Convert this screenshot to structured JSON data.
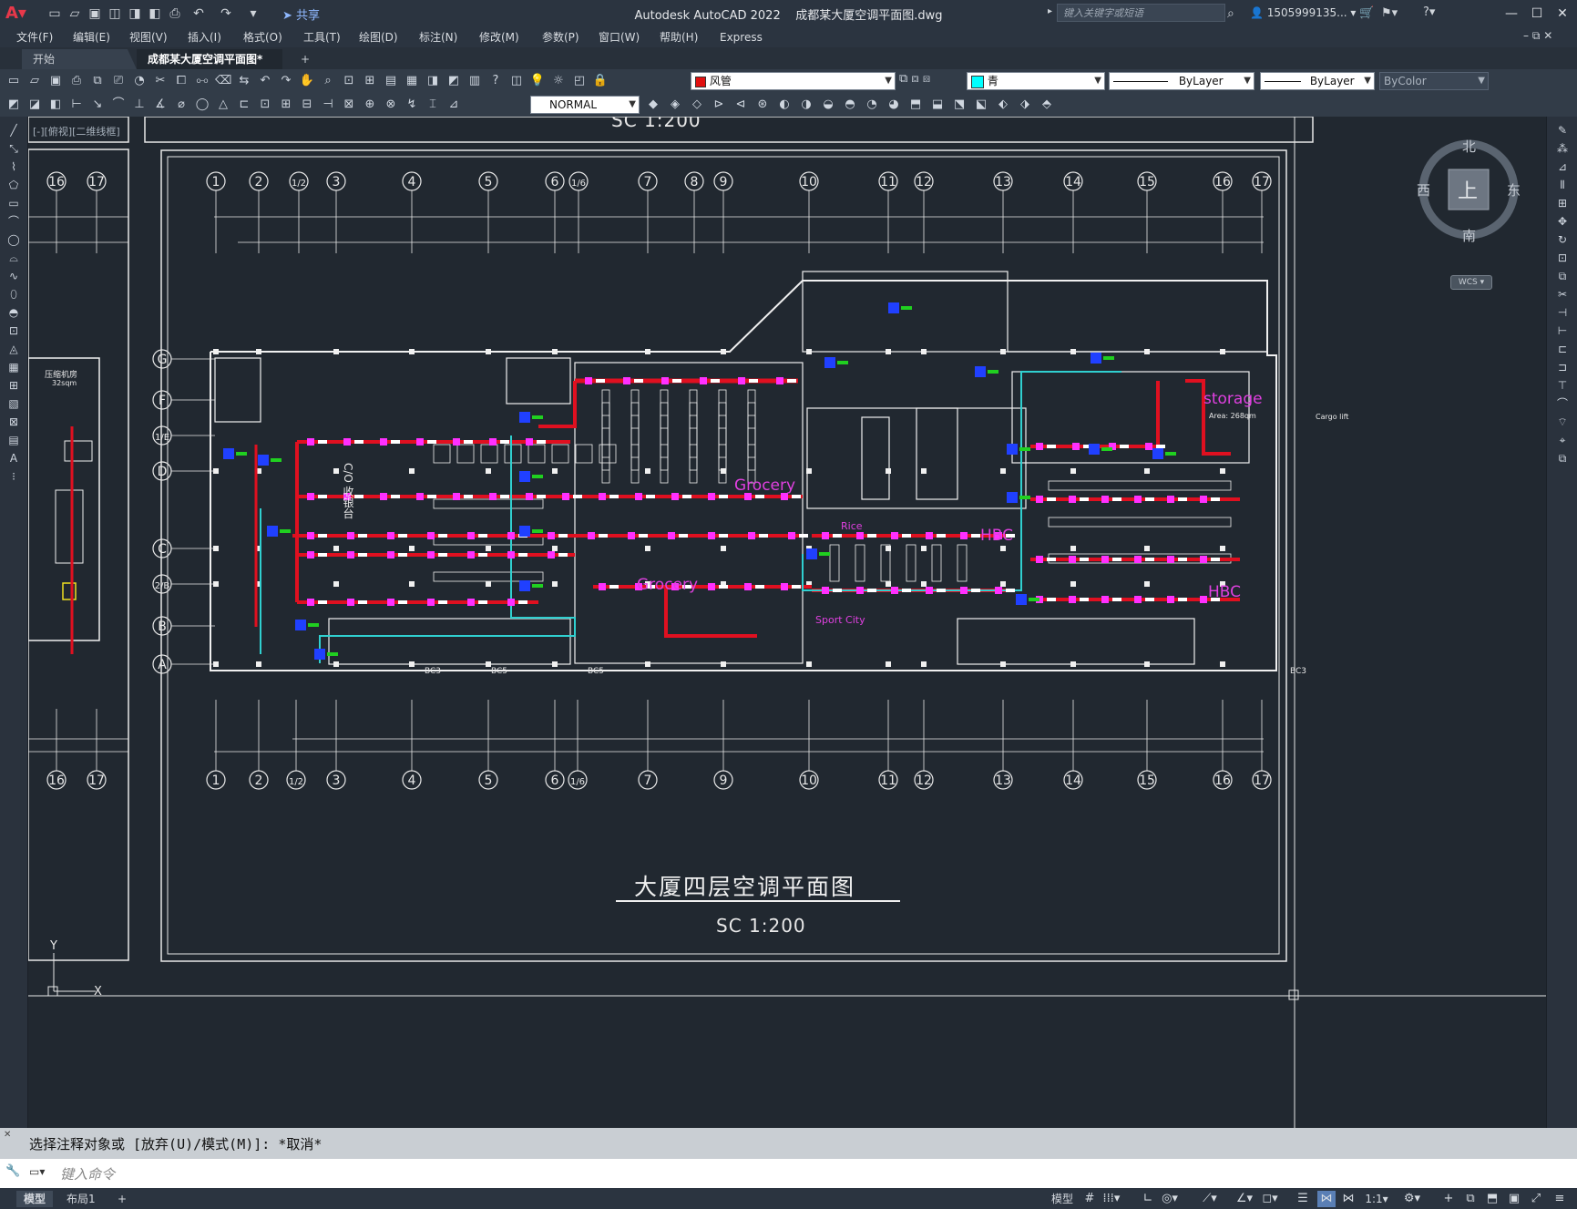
{
  "titlebar": {
    "app_name": "Autodesk AutoCAD 2022",
    "file_name": "成都某大厦空调平面图.dwg",
    "share_label": "共享",
    "search_placeholder": "键入关键字或短语",
    "user_name": "1505999135..."
  },
  "menubar": [
    "文件(F)",
    "编辑(E)",
    "视图(V)",
    "插入(I)",
    "格式(O)",
    "工具(T)",
    "绘图(D)",
    "标注(N)",
    "修改(M)",
    "参数(P)",
    "窗口(W)",
    "帮助(H)",
    "Express"
  ],
  "tabs": {
    "start": "开始",
    "drawing": "成都某大厦空调平面图*",
    "add": "+"
  },
  "properties": {
    "layer": "风管",
    "layer_color": "#e01010",
    "color": "青",
    "color_swatch": "#00ffff",
    "linetype": "ByLayer",
    "lineweight": "ByLayer",
    "plotstyle": "ByColor",
    "textstyle": "NORMAL"
  },
  "viewport_label": "[-][俯视][二维线框]",
  "viewcube": {
    "top": "上",
    "north": "北",
    "south": "南",
    "east": "东",
    "west": "西",
    "wcs": "WCS"
  },
  "drawing": {
    "main_title": "大厦四层空调平面图",
    "scale": "SC   1:200",
    "top_scale": "SC   1:200",
    "grid_top": [
      "1",
      "2",
      "1/2",
      "3",
      "4",
      "5",
      "6",
      "1/6",
      "7",
      "8",
      "9",
      "10",
      "11",
      "12",
      "13",
      "14",
      "15",
      "16",
      "17"
    ],
    "grid_bottom": [
      "1",
      "2",
      "1/2",
      "3",
      "4",
      "5",
      "6",
      "1/6",
      "7",
      "9",
      "10",
      "11",
      "12",
      "13",
      "14",
      "15",
      "16",
      "17"
    ],
    "grid_left": [
      "G",
      "F",
      "1/E",
      "D",
      "C",
      "2/B",
      "B",
      "A"
    ],
    "left_panel_grid": [
      "16",
      "17"
    ],
    "labels": {
      "grocery1": "Grocery",
      "grocery2": "Grocery",
      "hbc1": "HBC",
      "hbc2": "HBC",
      "storage": "storage",
      "storage_area": "Area: 268qm",
      "rice": "Rice",
      "sport_city": "Sport  City",
      "cargo_lift": "Cargo lift",
      "co_counter": "C/O 收银台",
      "compressor_room": "压缩机房",
      "compressor_area": "32sqm",
      "bc": "BC3",
      "bc5": "BC5"
    }
  },
  "command": {
    "history": "选择注释对象或 [放弃(U)/模式(M)]: *取消*",
    "placeholder": "键入命令"
  },
  "status": {
    "tab_model": "模型",
    "tab_layout": "布局1",
    "mode": "模型",
    "scale": "1:1"
  }
}
